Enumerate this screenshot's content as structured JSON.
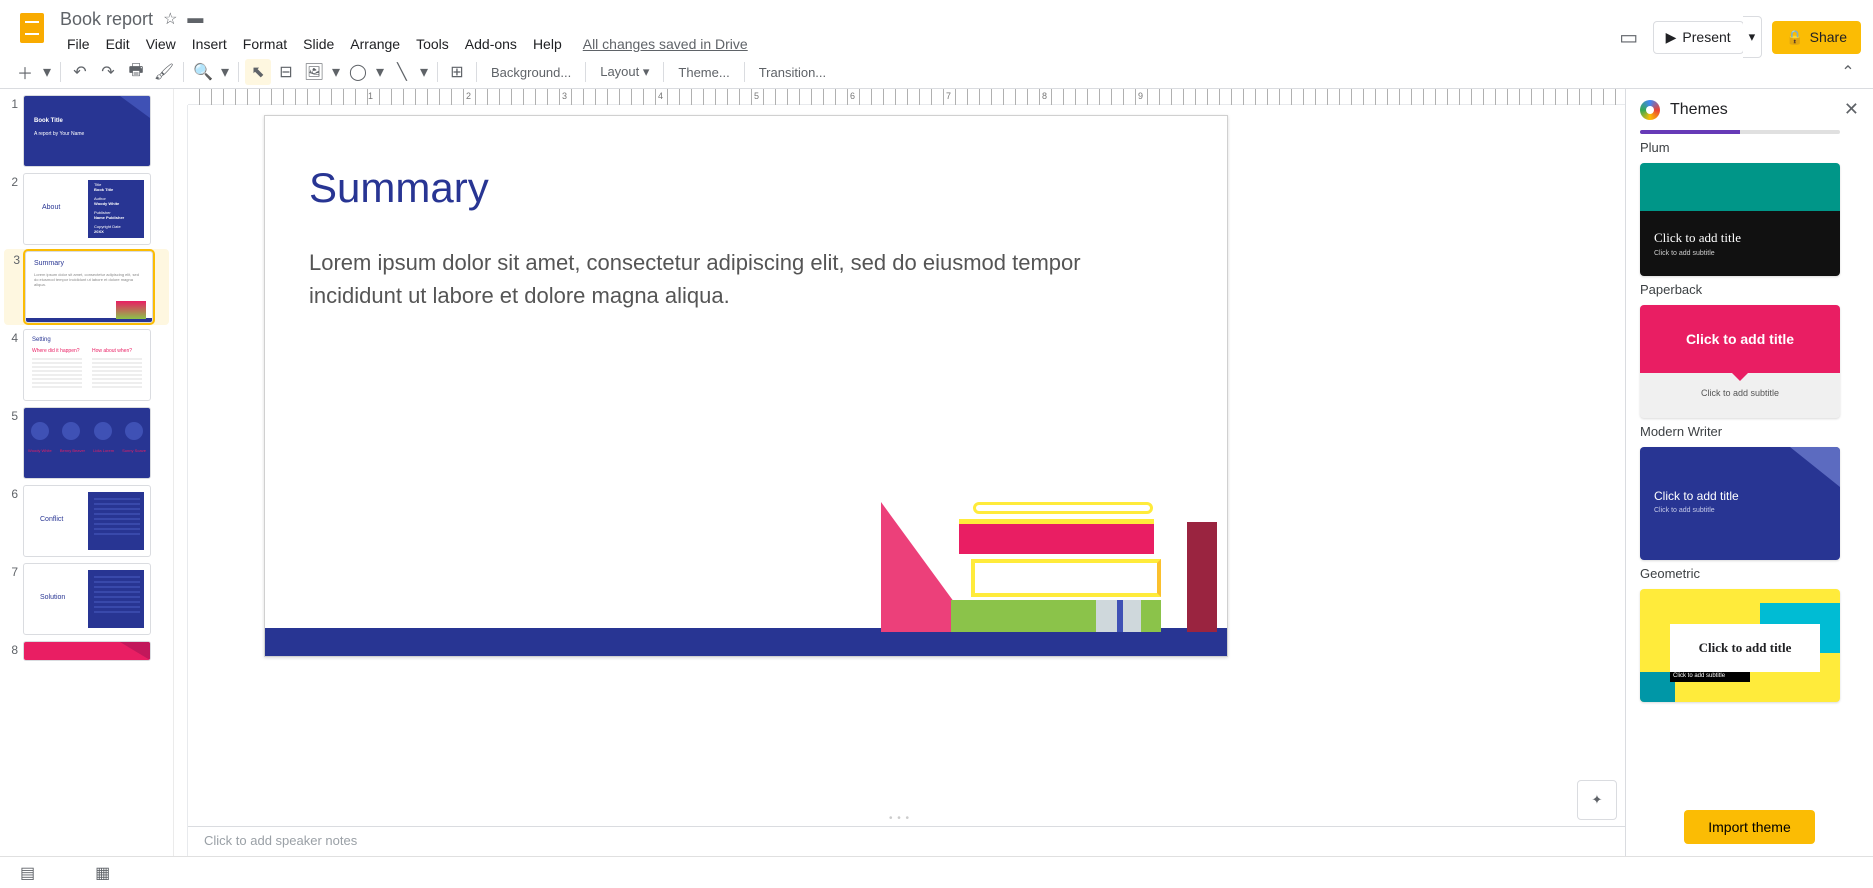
{
  "doc": {
    "title": "Book report",
    "saved": "All changes saved in Drive"
  },
  "menu": {
    "file": "File",
    "edit": "Edit",
    "view": "View",
    "insert": "Insert",
    "format": "Format",
    "slide": "Slide",
    "arrange": "Arrange",
    "tools": "Tools",
    "addons": "Add-ons",
    "help": "Help"
  },
  "header_btns": {
    "present": "Present",
    "share": "Share"
  },
  "toolbar": {
    "background": "Background...",
    "layout": "Layout",
    "theme": "Theme...",
    "transition": "Transition..."
  },
  "slide": {
    "title": "Summary",
    "body": "Lorem ipsum dolor sit amet, consectetur adipiscing elit, sed do eiusmod tempor incididunt ut labore et dolore magna aliqua."
  },
  "notes_placeholder": "Click to add speaker notes",
  "themes_panel": {
    "title": "Themes",
    "plum": "Plum",
    "paperback": "Paperback",
    "modern_writer": "Modern Writer",
    "geometric": "Geometric",
    "click_title": "Click to add title",
    "click_sub": "Click to add subtitle",
    "import": "Import theme"
  },
  "thumbs": {
    "t1_title": "Book Title",
    "t1_sub": "A report by Your Name",
    "t2": "About",
    "t2_a": "Title",
    "t2_b": "Book Title",
    "t2_c": "Author",
    "t2_d": "Woody White",
    "t2_e": "Publisher",
    "t2_f": "Name Publisher",
    "t2_g": "Copyright Date",
    "t2_h": "20XX",
    "t3_title": "Summary",
    "t3_body": "Lorem ipsum dolor sit amet, consectetur adipiscing elit, sed do eiusmod tempor incididunt ut labore et dolore magna aliqua.",
    "t4_title": "Setting",
    "t4_a": "Where did it happen?",
    "t4_b": "How about when?",
    "t5_a": "Woody White",
    "t5_b": "Benny Beaver",
    "t5_c": "Lidia Lorem",
    "t5_d": "Sunny Soave",
    "t6": "Conflict",
    "t7": "Solution"
  },
  "ruler": {
    "n1": "1",
    "n2": "2",
    "n3": "3",
    "n4": "4",
    "n5": "5",
    "n6": "6",
    "n7": "7",
    "n8": "8",
    "n9": "9"
  }
}
